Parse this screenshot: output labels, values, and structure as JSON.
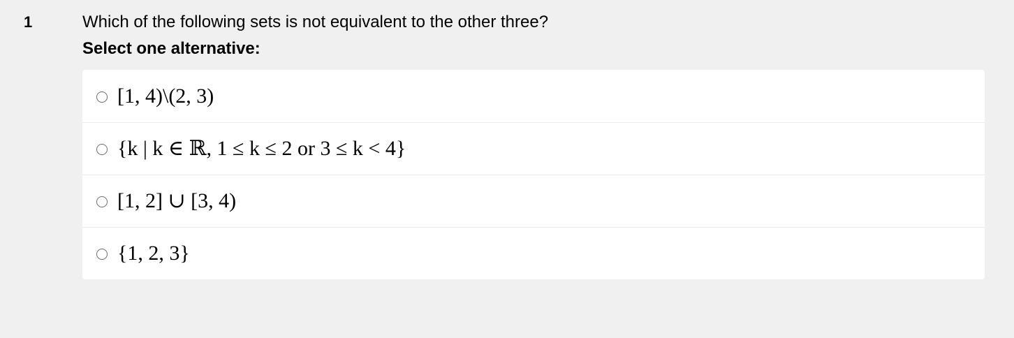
{
  "question": {
    "number": "1",
    "text": "Which of the following sets is not equivalent to the other three?",
    "instruction": "Select one alternative:"
  },
  "options": [
    {
      "label": "[1, 4)\\(2, 3)",
      "selected": false
    },
    {
      "label": "{k | k ∈ ℝ, 1 ≤ k ≤ 2 or 3 ≤ k < 4}",
      "selected": false
    },
    {
      "label": "[1, 2] ∪ [3, 4)",
      "selected": false
    },
    {
      "label": "{1, 2, 3}",
      "selected": false
    }
  ]
}
